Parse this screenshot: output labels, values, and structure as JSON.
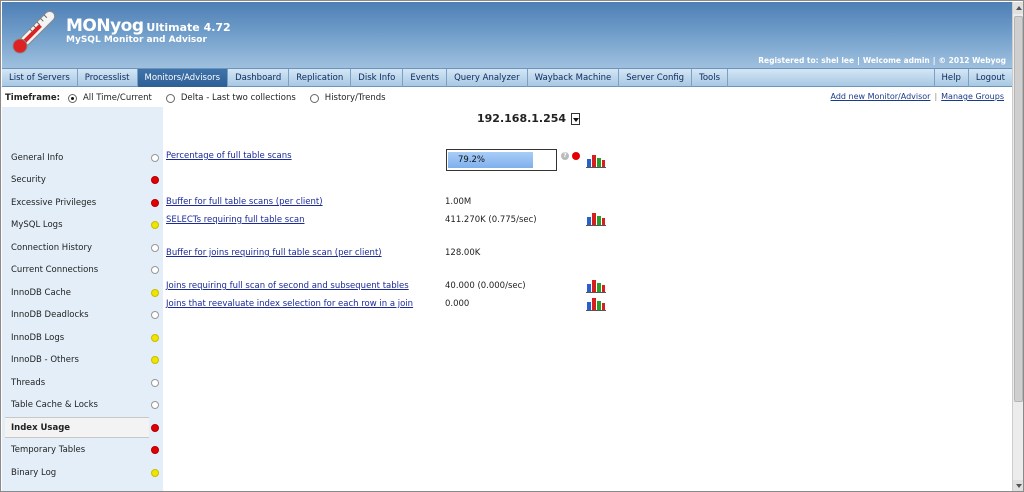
{
  "header": {
    "product_name": "MONyog",
    "edition": "Ultimate 4.72",
    "tagline": "MySQL Monitor and Advisor",
    "registered_to": "Registered to: shel lee",
    "welcome": "Welcome admin",
    "copyright": "© 2012 Webyog"
  },
  "nav": {
    "tabs": [
      {
        "label": "List of Servers"
      },
      {
        "label": "Processlist"
      },
      {
        "label": "Monitors/Advisors"
      },
      {
        "label": "Dashboard"
      },
      {
        "label": "Replication"
      },
      {
        "label": "Disk Info"
      },
      {
        "label": "Events"
      },
      {
        "label": "Query Analyzer"
      },
      {
        "label": "Wayback Machine"
      },
      {
        "label": "Server Config"
      },
      {
        "label": "Tools"
      }
    ],
    "active_index": 2,
    "help_label": "Help",
    "logout_label": "Logout"
  },
  "timeframe": {
    "label": "Timeframe:",
    "options": [
      {
        "label": "All Time/Current",
        "selected": true
      },
      {
        "label": "Delta - Last two collections",
        "selected": false
      },
      {
        "label": "History/Trends",
        "selected": false
      }
    ],
    "add_monitor_link": "Add new Monitor/Advisor",
    "manage_groups_link": "Manage Groups"
  },
  "server": {
    "selected": "192.168.1.254"
  },
  "sidebar": {
    "items": [
      {
        "label": "General Info",
        "status": "white"
      },
      {
        "label": "Security",
        "status": "red"
      },
      {
        "label": "Excessive Privileges",
        "status": "red"
      },
      {
        "label": "MySQL Logs",
        "status": "yellow"
      },
      {
        "label": "Connection History",
        "status": "white"
      },
      {
        "label": "Current Connections",
        "status": "white"
      },
      {
        "label": "InnoDB Cache",
        "status": "yellow"
      },
      {
        "label": "InnoDB Deadlocks",
        "status": "white"
      },
      {
        "label": "InnoDB Logs",
        "status": "yellow"
      },
      {
        "label": "InnoDB - Others",
        "status": "yellow"
      },
      {
        "label": "Threads",
        "status": "white"
      },
      {
        "label": "Table Cache & Locks",
        "status": "white"
      },
      {
        "label": "Index Usage",
        "status": "red",
        "active": true
      },
      {
        "label": "Temporary Tables",
        "status": "red"
      },
      {
        "label": "Binary Log",
        "status": "yellow"
      }
    ]
  },
  "metrics": {
    "full_table_scans_pct": {
      "label": "Percentage of full table scans",
      "value": "79.2%",
      "fraction": 0.792
    },
    "buffer_full_scans": {
      "label": "Buffer for full table scans (per client)",
      "value": "1.00M"
    },
    "selects_full_scan": {
      "label": "SELECTs requiring full table scan",
      "value": "411.270K (0.775/sec)"
    },
    "buffer_joins": {
      "label": "Buffer for joins requiring full table scan (per client)",
      "value": "128.00K"
    },
    "joins_full_scan": {
      "label": "Joins requiring full scan of second and subsequent tables",
      "value": "40.000 (0.000/sec)"
    },
    "joins_reevaluate": {
      "label": "Joins that reevaluate index selection for each row in a join",
      "value": "0.000"
    }
  },
  "icons": {
    "logo": "thermometer-icon",
    "help": "question-icon",
    "status_dot": "alert-dot-icon",
    "chart": "bar-chart-icon"
  },
  "colors": {
    "active_tab": "#2d5f96",
    "status_red": "#e30000",
    "status_yellow": "#f0e400",
    "progress_fill": "#7fb0ee"
  }
}
